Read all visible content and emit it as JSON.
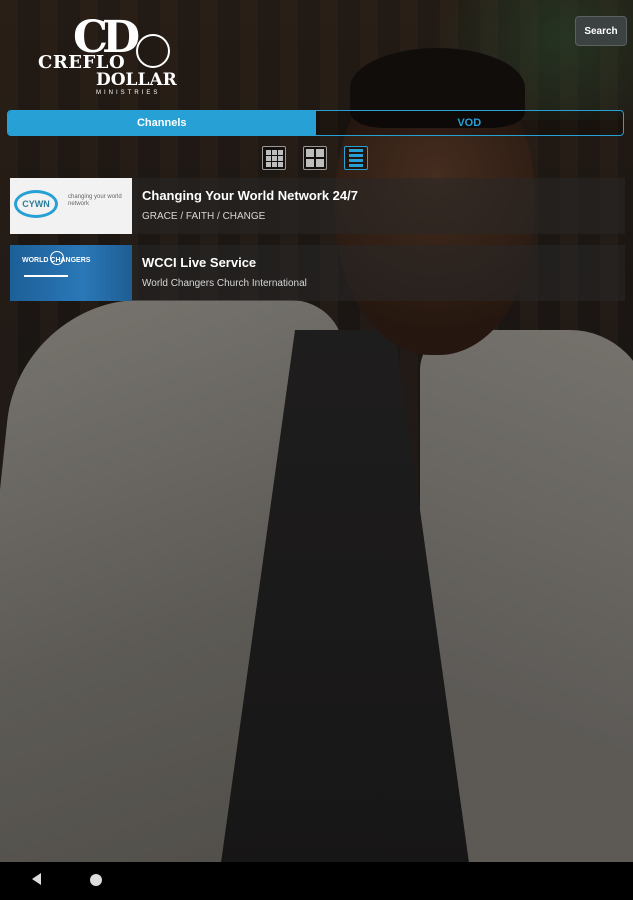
{
  "header": {
    "logo": {
      "line1": "CREFLO",
      "line2": "DOLLAR",
      "line3": "MINISTRIES",
      "mark": "CD"
    },
    "search_label": "Search"
  },
  "tabs": [
    {
      "label": "Channels",
      "active": true
    },
    {
      "label": "VOD",
      "active": false
    }
  ],
  "views": [
    "grid-9-icon",
    "grid-4-icon",
    "list-icon"
  ],
  "channels": [
    {
      "title": "Changing Your World Network  24/7",
      "subtitle": "GRACE / FAITH / CHANGE",
      "thumb": {
        "badge": "CYWN",
        "text": "changing your world network"
      }
    },
    {
      "title": "WCCI Live Service",
      "subtitle": "World Changers Church International",
      "thumb": {
        "text": "WORLD CHANGERS"
      }
    }
  ],
  "colors": {
    "accent": "#27a0d6"
  }
}
